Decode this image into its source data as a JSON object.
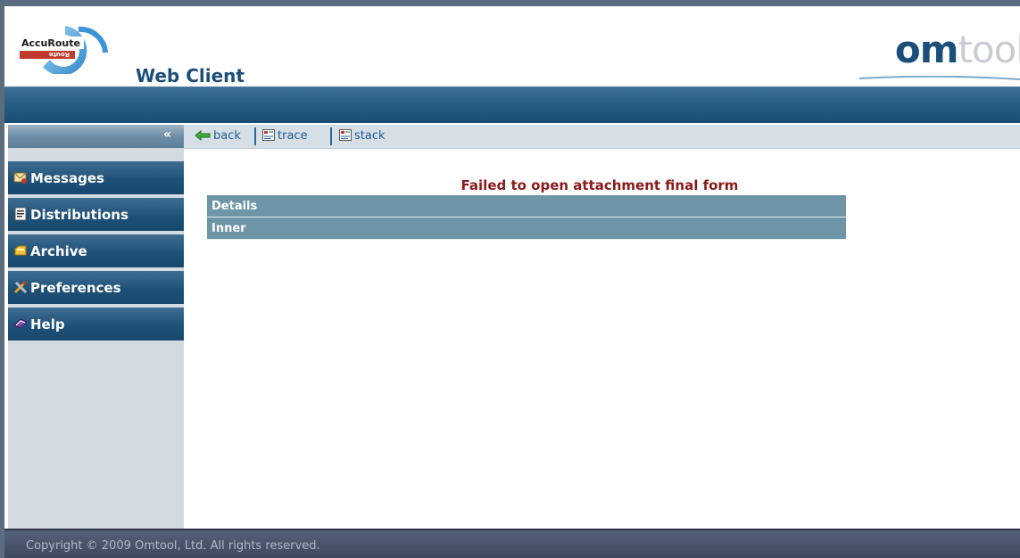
{
  "header": {
    "logo_text": "AccuRoute",
    "logo_sub": "Route",
    "app_title": "Web Client",
    "brand_part1": "om",
    "brand_part2": "tool"
  },
  "sidebar": {
    "collapse_icon": "«",
    "items": [
      {
        "label": "Messages",
        "icon": "messages-icon"
      },
      {
        "label": "Distributions",
        "icon": "distributions-icon"
      },
      {
        "label": "Archive",
        "icon": "archive-icon"
      },
      {
        "label": "Preferences",
        "icon": "preferences-icon"
      },
      {
        "label": "Help",
        "icon": "help-icon"
      }
    ]
  },
  "toolbar": {
    "back_label": "back",
    "trace_label": "trace",
    "stack_label": "stack"
  },
  "error": {
    "title": "Failed to open attachment final form",
    "rows": [
      "Details",
      "Inner"
    ]
  },
  "footer": {
    "copyright": "Copyright © 2009 Omtool, Ltd. All rights reserved."
  },
  "colors": {
    "nav_blue": "#1f5178",
    "error_red": "#8b1a1a",
    "row_bg": "#6f95a8"
  }
}
